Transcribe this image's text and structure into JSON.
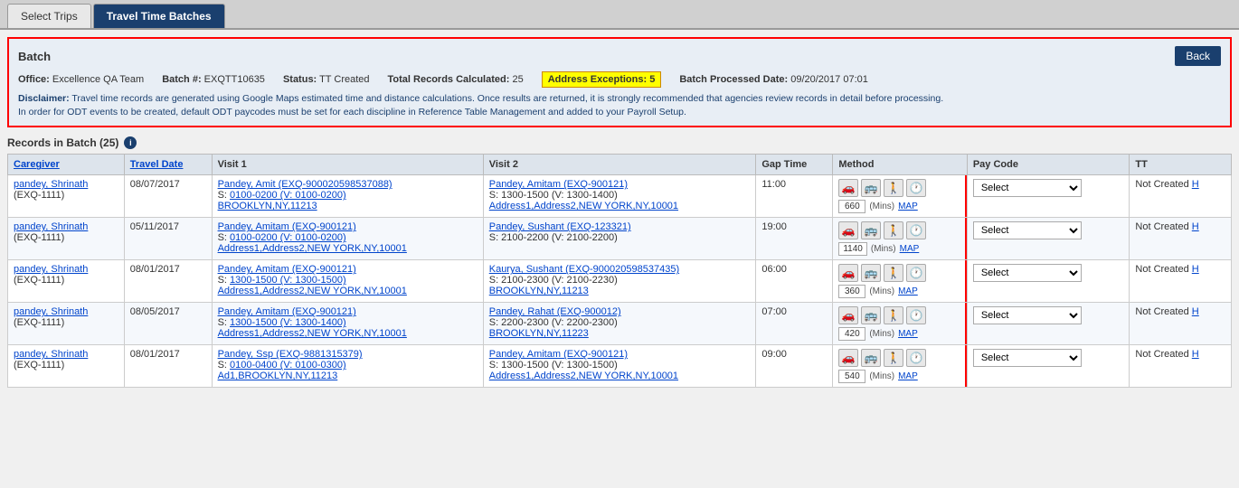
{
  "tabs": [
    {
      "label": "Select Trips",
      "active": false
    },
    {
      "label": "Travel Time Batches",
      "active": true
    }
  ],
  "batch": {
    "title": "Batch",
    "back_label": "Back",
    "office_label": "Office:",
    "office_value": "Excellence QA Team",
    "batch_num_label": "Batch #:",
    "batch_num_value": "EXQTT10635",
    "status_label": "Status:",
    "status_value": "TT Created",
    "total_records_label": "Total Records Calculated:",
    "total_records_value": "25",
    "address_exceptions_label": "Address Exceptions:",
    "address_exceptions_value": "5",
    "batch_processed_label": "Batch Processed Date:",
    "batch_processed_value": "09/20/2017 07:01",
    "disclaimer_bold": "Disclaimer:",
    "disclaimer_text": " Travel time records are generated using Google Maps estimated time and distance calculations. Once results are returned, it is strongly recommended that agencies review records in detail before processing.",
    "disclaimer_line2": "In order for ODT events to be created, default ODT paycodes must be set for each discipline in Reference Table Management and added to your Payroll Setup."
  },
  "records": {
    "header": "Records in Batch (25)",
    "info_icon": "i",
    "columns": [
      "Caregiver",
      "Travel Date",
      "Visit 1",
      "Visit 2",
      "Gap Time",
      "Method",
      "Pay Code",
      "TT"
    ],
    "rows": [
      {
        "caregiver": "pandey, Shrinath",
        "caregiver_id": "(EXQ-1111)",
        "travel_date": "08/07/2017",
        "visit1_name": "Pandey, Amit (EXQ-900020598537088)",
        "visit1_s": "S: 0100-0200 (V: 0100-0200)",
        "visit1_addr": "BROOKLYN,NY,11213",
        "visit2_name": "Pandey, Amitam (EXQ-900121)",
        "visit2_s": "S: 1300-1500 (V: 1300-1400)",
        "visit2_addr": "Address1,Address2,NEW YORK,NY,10001",
        "gap_time": "11:00",
        "mins": "660",
        "pay_code": "Select",
        "tt": "Not Created",
        "h": "H"
      },
      {
        "caregiver": "pandey, Shrinath",
        "caregiver_id": "(EXQ-1111)",
        "travel_date": "05/11/2017",
        "visit1_name": "Pandey, Amitam (EXQ-900121)",
        "visit1_s": "S: 0100-0200 (V: 0100-0200)",
        "visit1_addr": "Address1,Address2,NEW YORK,NY,10001",
        "visit2_name": "Pandey, Sushant (EXQ-123321)",
        "visit2_s": "S: 2100-2200 (V: 2100-2200)",
        "visit2_addr": "",
        "gap_time": "19:00",
        "mins": "1140",
        "pay_code": "Select",
        "tt": "Not Created",
        "h": "H"
      },
      {
        "caregiver": "pandey, Shrinath",
        "caregiver_id": "(EXQ-1111)",
        "travel_date": "08/01/2017",
        "visit1_name": "Pandey, Amitam (EXQ-900121)",
        "visit1_s": "S: 1300-1500 (V: 1300-1500)",
        "visit1_addr": "Address1,Address2,NEW YORK,NY,10001",
        "visit2_name": "Kaurya, Sushant (EXQ-900020598537435)",
        "visit2_s": "S: 2100-2300 (V: 2100-2230)",
        "visit2_addr": "BROOKLYN,NY,11213",
        "gap_time": "06:00",
        "mins": "360",
        "pay_code": "Select",
        "tt": "Not Created",
        "h": "H"
      },
      {
        "caregiver": "pandey, Shrinath",
        "caregiver_id": "(EXQ-1111)",
        "travel_date": "08/05/2017",
        "visit1_name": "Pandey, Amitam (EXQ-900121)",
        "visit1_s": "S: 1300-1500 (V: 1300-1400)",
        "visit1_addr": "Address1,Address2,NEW YORK,NY,10001",
        "visit2_name": "Pandey, Rahat (EXQ-900012)",
        "visit2_s": "S: 2200-2300 (V: 2200-2300)",
        "visit2_addr": "BROOKLYN,NY,11223",
        "gap_time": "07:00",
        "mins": "420",
        "pay_code": "Select",
        "tt": "Not Created",
        "h": "H"
      },
      {
        "caregiver": "pandey, Shrinath",
        "caregiver_id": "(EXQ-1111)",
        "travel_date": "08/01/2017",
        "visit1_name": "Pandey, Ssp (EXQ-9881315379)",
        "visit1_s": "S: 0100-0400 (V: 0100-0300)",
        "visit1_addr": "Ad1,BROOKLYN,NY,11213",
        "visit2_name": "Pandey, Amitam (EXQ-900121)",
        "visit2_s": "S: 1300-1500 (V: 1300-1500)",
        "visit2_addr": "Address1,Address2,NEW YORK,NY,10001",
        "gap_time": "09:00",
        "mins": "540",
        "pay_code": "Select",
        "tt": "Not Created",
        "h": "H"
      }
    ]
  }
}
